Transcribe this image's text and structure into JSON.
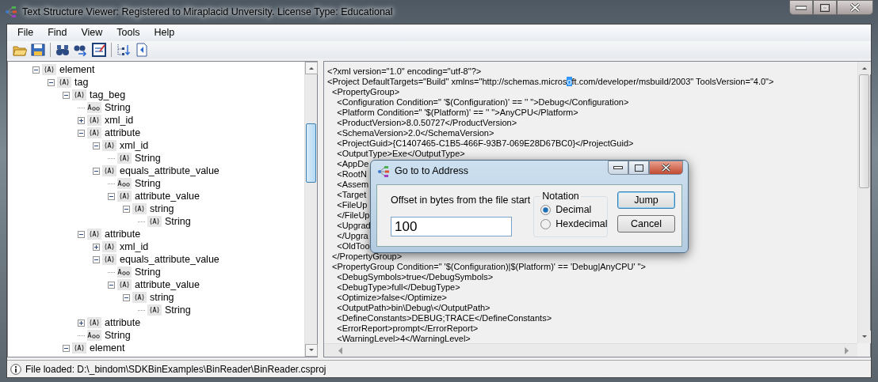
{
  "window": {
    "title": "Text Structure Viewer: Registered to Miraplacid Unversity. License Type: Educational"
  },
  "menu": [
    "File",
    "Find",
    "View",
    "Tools",
    "Help"
  ],
  "tree": {
    "items": [
      {
        "label": "element",
        "kind": "object",
        "expanded": true,
        "children": [
          {
            "label": "tag",
            "kind": "object",
            "expanded": true,
            "children": [
              {
                "label": "tag_beg",
                "kind": "object",
                "expanded": true,
                "children": [
                  {
                    "label": "String",
                    "kind": "text"
                  },
                  {
                    "label": "xml_id",
                    "kind": "object",
                    "expanded": false
                  },
                  {
                    "label": "attribute",
                    "kind": "object",
                    "expanded": true,
                    "children": [
                      {
                        "label": "xml_id",
                        "kind": "object",
                        "expanded": true,
                        "children": [
                          {
                            "label": "String",
                            "kind": "object"
                          }
                        ]
                      },
                      {
                        "label": "equals_attribute_value",
                        "kind": "object",
                        "expanded": true,
                        "children": [
                          {
                            "label": "String",
                            "kind": "text"
                          },
                          {
                            "label": "attribute_value",
                            "kind": "object",
                            "expanded": true,
                            "children": [
                              {
                                "label": "string",
                                "kind": "object",
                                "expanded": true,
                                "children": [
                                  {
                                    "label": "String",
                                    "kind": "object"
                                  }
                                ]
                              }
                            ]
                          }
                        ]
                      }
                    ]
                  },
                  {
                    "label": "attribute",
                    "kind": "object",
                    "expanded": true,
                    "children": [
                      {
                        "label": "xml_id",
                        "kind": "object",
                        "expanded": false
                      },
                      {
                        "label": "equals_attribute_value",
                        "kind": "object",
                        "expanded": true,
                        "children": [
                          {
                            "label": "String",
                            "kind": "text"
                          },
                          {
                            "label": "attribute_value",
                            "kind": "object",
                            "expanded": true,
                            "children": [
                              {
                                "label": "string",
                                "kind": "object",
                                "expanded": true,
                                "children": [
                                  {
                                    "label": "String",
                                    "kind": "object"
                                  }
                                ]
                              }
                            ]
                          }
                        ]
                      }
                    ]
                  },
                  {
                    "label": "attribute",
                    "kind": "object",
                    "expanded": false
                  },
                  {
                    "label": "String",
                    "kind": "text"
                  }
                ]
              },
              {
                "label": "element",
                "kind": "object",
                "expanded": true
              }
            ]
          }
        ]
      }
    ]
  },
  "source": {
    "lines": [
      {
        "text": "<?xml version=\"1.0\" encoding=\"utf-8\"?>"
      },
      {
        "text": "<Project DefaultTargets=\"Build\" xmlns=\"http://schemas.micros",
        "selected_text": "o",
        "text_after": "ft.com/developer/msbuild/2003\" ToolsVersion=\"4.0\">"
      },
      {
        "text": "  <PropertyGroup>"
      },
      {
        "text": "    <Configuration Condition=\" '$(Configuration)' == '' \">Debug</Configuration>"
      },
      {
        "text": "    <Platform Condition=\" '$(Platform)' == '' \">AnyCPU</Platform>"
      },
      {
        "text": "    <ProductVersion>8.0.50727</ProductVersion>"
      },
      {
        "text": "    <SchemaVersion>2.0</SchemaVersion>"
      },
      {
        "text": "    <ProjectGuid>{C1407465-C1B5-466F-93B7-069E28D67BC0}</ProjectGuid>"
      },
      {
        "text": "    <OutputType>Exe</OutputType>"
      },
      {
        "text": "    <AppDe"
      },
      {
        "text": "    <RootN"
      },
      {
        "text": "    <Assem"
      },
      {
        "text": "    <Target"
      },
      {
        "text": "    <FileUp"
      },
      {
        "text": "    </FileUp"
      },
      {
        "text": "    <Upgrad"
      },
      {
        "text": "    </Upgra"
      },
      {
        "text": "    <OldToo"
      },
      {
        "text": "  </PropertyGroup>"
      },
      {
        "text": "  <PropertyGroup Condition=\" '$(Configuration)|$(Platform)' == 'Debug|AnyCPU' \">"
      },
      {
        "text": "    <DebugSymbols>true</DebugSymbols>"
      },
      {
        "text": "    <DebugType>full</DebugType>"
      },
      {
        "text": "    <Optimize>false</Optimize>"
      },
      {
        "text": "    <OutputPath>bin\\Debug\\</OutputPath>"
      },
      {
        "text": "    <DefineConstants>DEBUG;TRACE</DefineConstants>"
      },
      {
        "text": "    <ErrorReport>prompt</ErrorReport>"
      },
      {
        "text": "    <WarningLevel>4</WarningLevel>"
      }
    ]
  },
  "dialog": {
    "title": "Go to to Address",
    "offset_label": "Offset in bytes from the file start",
    "offset_value": "100",
    "notation": {
      "legend": "Notation",
      "options": [
        {
          "label": "Decimal",
          "selected": true
        },
        {
          "label": "Hexdecimal",
          "selected": false
        }
      ]
    },
    "buttons": [
      {
        "label": "Jump",
        "default": true
      },
      {
        "label": "Cancel",
        "default": false
      }
    ]
  },
  "status_bar": {
    "text": "File loaded: D:\\_bindom\\SDKBinExamples\\BinReader\\BinReader.csproj"
  }
}
